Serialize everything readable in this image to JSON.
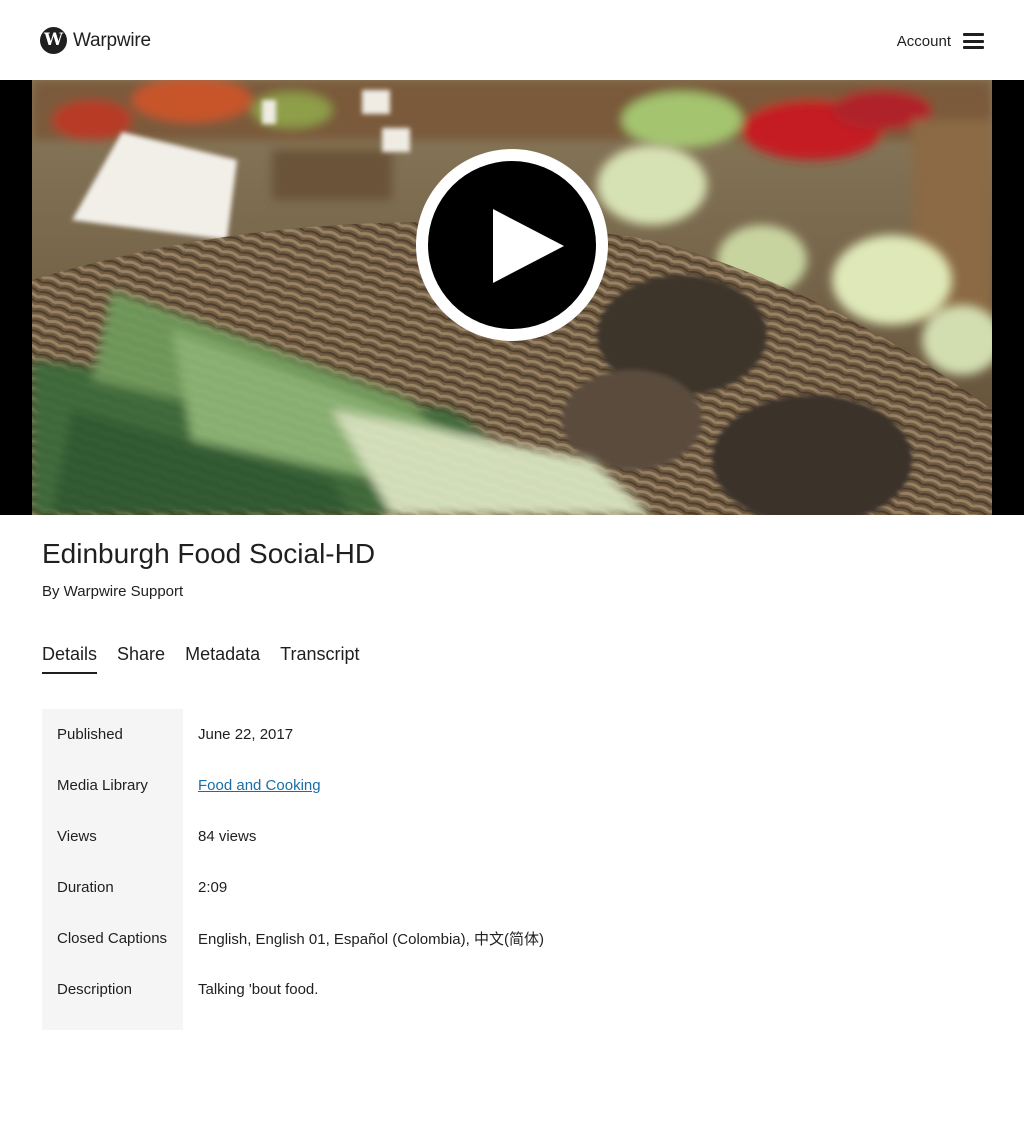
{
  "header": {
    "logo_letter": "W",
    "brand": "Warpwire",
    "account_label": "Account"
  },
  "player": {
    "play_icon": "play-icon"
  },
  "video": {
    "title": "Edinburgh Food Social-HD",
    "byline": "By Warpwire Support"
  },
  "tabs": [
    {
      "label": "Details",
      "active": true
    },
    {
      "label": "Share",
      "active": false
    },
    {
      "label": "Metadata",
      "active": false
    },
    {
      "label": "Transcript",
      "active": false
    }
  ],
  "details": {
    "published": {
      "label": "Published",
      "value": "June 22, 2017"
    },
    "media_library": {
      "label": "Media Library",
      "value": "Food and Cooking"
    },
    "views": {
      "label": "Views",
      "value": "84 views"
    },
    "duration": {
      "label": "Duration",
      "value": "2:09"
    },
    "closed_captions": {
      "label": "Closed Captions",
      "value": "English, English 01, Español (Colombia), 中文(简体)"
    },
    "description": {
      "label": "Description",
      "value": "Talking 'bout food."
    }
  },
  "colors": {
    "text": "#1f1f1f",
    "link": "#1a6ea8",
    "label_bg": "#f5f5f5",
    "player_bg": "#000000"
  }
}
